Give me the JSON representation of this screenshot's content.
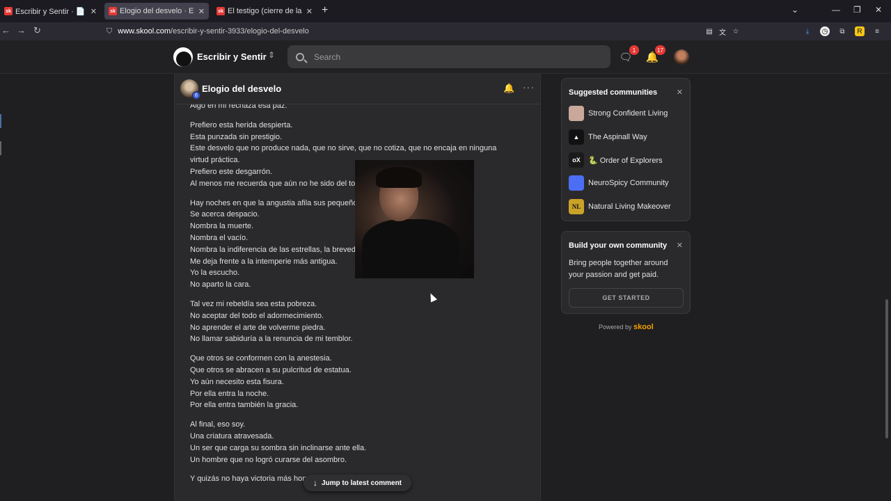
{
  "browser": {
    "tabs": [
      {
        "favicon": "sk",
        "title": "Escribir y Sentir · 📄 | Textos pr",
        "active": false
      },
      {
        "favicon": "sk",
        "title": "Elogio del desvelo · Escribir y Se",
        "active": true
      },
      {
        "favicon": "sk",
        "title": "El testigo (cierre de la saga de",
        "active": false
      }
    ],
    "url_host": "www.skool.com",
    "url_path": "/escribir-y-sentir-3933/elogio-del-desvelo"
  },
  "header": {
    "community_name": "Escribir y Sentir",
    "search_placeholder": "Search",
    "chat_badge": "1",
    "notif_badge": "17"
  },
  "post": {
    "title": "Elogio del desvelo",
    "author_level": "6",
    "stanzas": [
      [
        "Algo en mí rechaza esa paz."
      ],
      [
        "Prefiero esta herida despierta.",
        "Esta punzada sin prestigio.",
        "Este desvelo que no produce nada, que no sirve, que no cotiza, que no encaja en ninguna virtud práctica.",
        "Prefiero este desgarrón.",
        "Al menos me recuerda que aún no he sido del tod"
      ],
      [
        "Hay noches en que la angustia afila sus pequeño",
        "Se acerca despacio.",
        "Nombra la muerte.",
        "Nombra el vacío.",
        "Nombra la indiferencia de las estrellas, la brevedad                                            do cuanto amamos.",
        "Me deja frente a la intemperie más antigua.",
        "Yo la escucho.",
        "No aparto la cara."
      ],
      [
        "Tal vez mi rebeldía sea esta pobreza.",
        "No aceptar del todo el adormecimiento.",
        "No aprender el arte de volverme piedra.",
        "No llamar sabiduría a la renuncia de mi temblor."
      ],
      [
        "Que otros se conformen con la anestesia.",
        "Que otros se abracen a su pulcritud de estatua.",
        "Yo aún necesito esta fisura.",
        "Por ella entra la noche.",
        "Por ella entra también la gracia."
      ],
      [
        "Al final, eso soy.",
        "Una criatura atravesada.",
        "Un ser que carga su sombra sin inclinarse ante ella.",
        "Un hombre que no logró curarse del asombro."
      ],
      [
        "Y quizás no haya victoria más hono"
      ]
    ],
    "jump_label": "Jump to latest comment"
  },
  "sidebar": {
    "suggested_title": "Suggested communities",
    "communities": [
      {
        "name": "Strong Confident Living",
        "thumb": "",
        "color": "#c9a79a"
      },
      {
        "name": "The Aspinall Way",
        "thumb": "▲",
        "color": "#111111"
      },
      {
        "name": "🐍 Order of Explorers",
        "thumb": "oX",
        "color": "#1a1a1a"
      },
      {
        "name": "NeuroSpicy Community",
        "thumb": "",
        "color": "#4c6ef5"
      },
      {
        "name": "Natural Living Makeover",
        "thumb": "NL",
        "color": "#c9a227"
      }
    ],
    "build_title": "Build your own community",
    "build_text": "Bring people together around your passion and get paid.",
    "build_button": "GET STARTED",
    "powered_by": "Powered by",
    "powered_brand": "skool"
  }
}
